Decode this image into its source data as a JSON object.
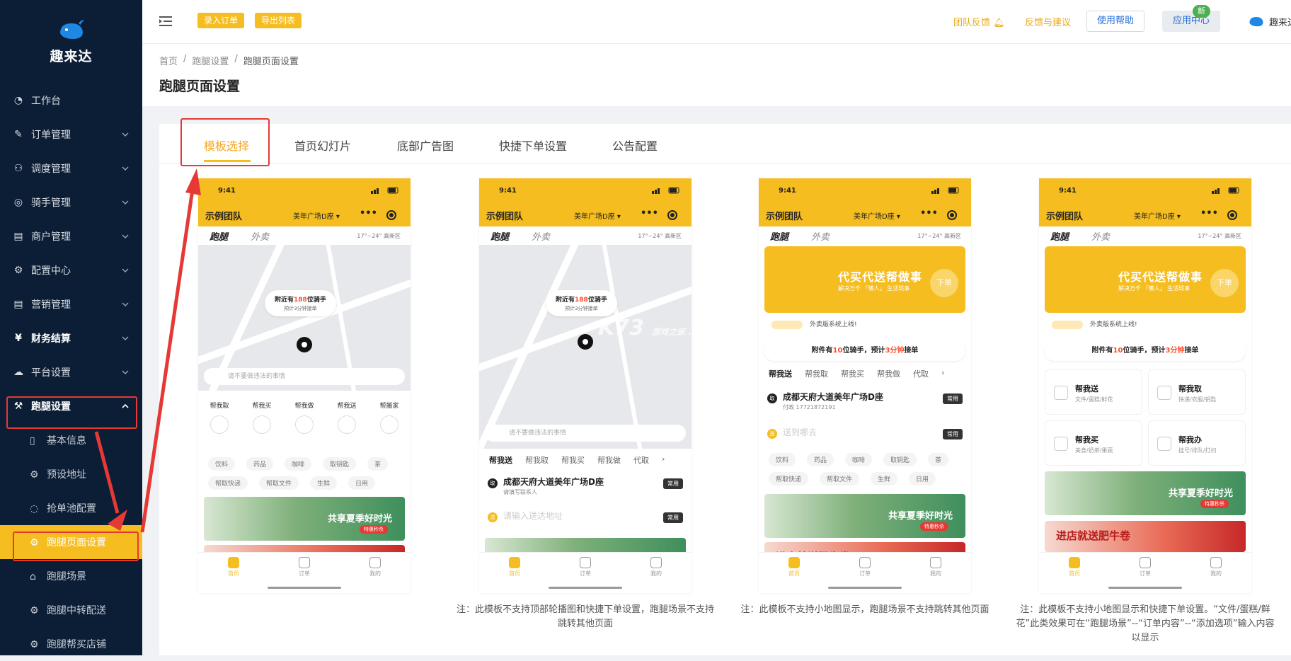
{
  "sidebar": {
    "brand": "趣来达",
    "menu": [
      {
        "label": "工作台",
        "icon": "dashboard-icon"
      },
      {
        "label": "订单管理",
        "icon": "edit-icon"
      },
      {
        "label": "调度管理",
        "icon": "user-icon"
      },
      {
        "label": "骑手管理",
        "icon": "check-circle-icon"
      },
      {
        "label": "商户管理",
        "icon": "store-icon"
      },
      {
        "label": "配置中心",
        "icon": "gear-icon"
      },
      {
        "label": "营销管理",
        "icon": "store-icon"
      },
      {
        "label": "财务结算",
        "icon": "yen-icon"
      },
      {
        "label": "平台设置",
        "icon": "cloud-gear-icon"
      },
      {
        "label": "跑腿设置",
        "icon": "wrench-icon"
      }
    ],
    "submenu": [
      {
        "label": "基本信息"
      },
      {
        "label": "预设地址"
      },
      {
        "label": "抢单池配置"
      },
      {
        "label": "跑腿页面设置"
      },
      {
        "label": "跑腿场景"
      },
      {
        "label": "跑腿中转配送"
      },
      {
        "label": "跑腿帮买店铺"
      }
    ]
  },
  "header": {
    "btn_order": "录入订单",
    "btn_export": "导出列表",
    "team_feedback": "团队反馈",
    "feedback": "反馈与建议",
    "help": "使用帮助",
    "app_center": "应用中心",
    "new_badge": "新",
    "user": "趣来达"
  },
  "breadcrumb": [
    "首页",
    "/",
    "跑腿设置",
    "/",
    "跑腿页面设置"
  ],
  "page_title": "跑腿页面设置",
  "tabs": [
    "模板选择",
    "首页幻灯片",
    "底部广告图",
    "快捷下单设置",
    "公告配置"
  ],
  "phone": {
    "time": "9:41",
    "team": "示例团队",
    "location": "美年广场D座 ▾",
    "dots": "•••",
    "tab_run": "跑腿",
    "tab_takeout": "外卖",
    "weather": "17°~24° 高新区",
    "bubble_pre": "附近有",
    "bubble_num": "188",
    "bubble_post": "位骑手",
    "bubble_l2": "预计3分钟接单",
    "search_ph": "请不要做违法的事情",
    "services": [
      "帮我取",
      "帮我买",
      "帮我做",
      "帮我送",
      "帮搬家"
    ],
    "chips": [
      "饮料",
      "药品",
      "咖啡",
      "取钥匙",
      "茶",
      "帮取快递",
      "帮取文件",
      "生鲜",
      "日用"
    ],
    "banner_green": "共享夏季好时光",
    "banner_green_sub": "特惠秒杀",
    "banner_red": "进店就送肥牛卷",
    "banner_yellow": "代买代送帮做事",
    "banner_yellow_sub": "解决万千 「懒人」 生活琐事",
    "banner_yellow_btn": "下单",
    "notice": "外卖版系统上线!",
    "riders_pre": "附件有",
    "riders_num": "10",
    "riders_mid": "位骑手，预计",
    "riders_time": "3分钟",
    "riders_post": "接单",
    "subtabs": [
      "帮我送",
      "帮我取",
      "帮我买",
      "帮我做",
      "代取",
      "›"
    ],
    "addr1": "成都天府大道美年广场D座",
    "addr1_sub_a": "请填写联系人",
    "addr1_sub_b": "付政 17721872191",
    "addr2_a": "请输入送达地址",
    "addr2_b": "送到哪去",
    "tag_common": "常用",
    "dot_take": "取",
    "dot_send": "送",
    "grid": [
      {
        "t": "帮我送",
        "s": "文件/蛋糕/鲜花"
      },
      {
        "t": "帮我取",
        "s": "快递/衣服/钥匙"
      },
      {
        "t": "帮我买",
        "s": "美食/奶茶/果蔬"
      },
      {
        "t": "帮我办",
        "s": "挂号/排队/打扫"
      }
    ],
    "nav": [
      "首页",
      "订单",
      "我的"
    ]
  },
  "notes": {
    "n2": "注：此模板不支持顶部轮播图和快捷下单设置，跑腿场景不支持跳转其他页面",
    "n3": "注：此模板不支持小地图显示，跑腿场景不支持跳转其他页面",
    "n4": "注：此模板不支持小地图显示和快捷下单设置。“文件/蛋糕/鲜花”此类效果可在“跑腿场景”--“订单内容”--“添加选项”输入内容以显示"
  },
  "watermark": "K73",
  "watermark_sub": "游戏之家 .com",
  "colors": {
    "accent": "#f5bd1f",
    "sidebar_bg": "#0c1e35",
    "annotation": "#e53935",
    "link": "#1e6bd6"
  }
}
